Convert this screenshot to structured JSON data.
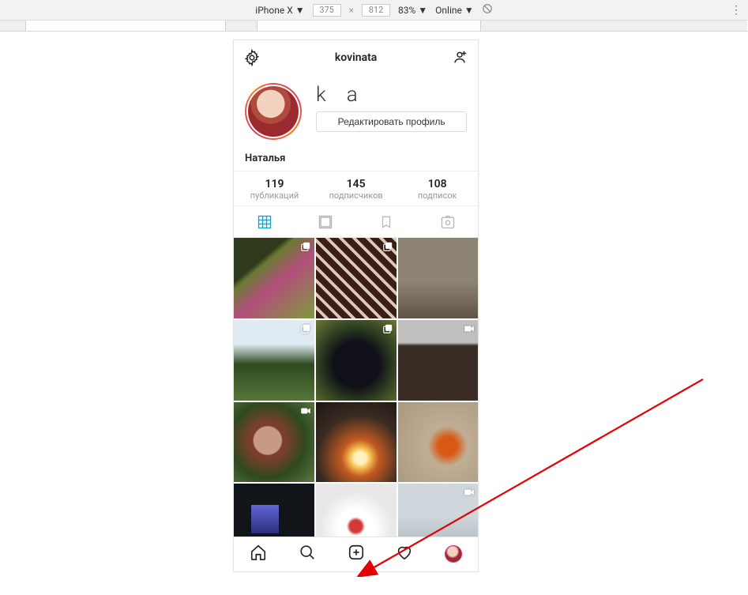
{
  "devtools": {
    "device": "iPhone X ▼",
    "width": "375",
    "height": "812",
    "dim_sep": "×",
    "zoom": "83% ▼",
    "throttle": "Online ▼"
  },
  "header": {
    "username": "kovinata"
  },
  "profile": {
    "username_big": "ka",
    "edit_label": "Редактировать профиль",
    "display_name": "Наталья"
  },
  "stats": {
    "posts": {
      "num": "119",
      "label": "публикаций"
    },
    "followers": {
      "num": "145",
      "label": "подписчиков"
    },
    "following": {
      "num": "108",
      "label": "подписок"
    }
  },
  "grid": {
    "cells": [
      {
        "badge": "multi"
      },
      {
        "badge": "multi"
      },
      {
        "badge": null
      },
      {
        "badge": "multi"
      },
      {
        "badge": "multi"
      },
      {
        "badge": "video"
      },
      {
        "badge": "video"
      },
      {
        "badge": null
      },
      {
        "badge": null
      },
      {
        "badge": null
      },
      {
        "badge": null
      },
      {
        "badge": "video"
      }
    ]
  },
  "icons": {
    "gear": "gear-icon",
    "adduser": "add-user-icon",
    "grid": "grid-icon",
    "feed": "feed-icon",
    "saved": "bookmark-icon",
    "tagged": "tagged-icon",
    "home": "home-icon",
    "search": "search-icon",
    "new": "plus-icon",
    "activity": "heart-icon"
  }
}
